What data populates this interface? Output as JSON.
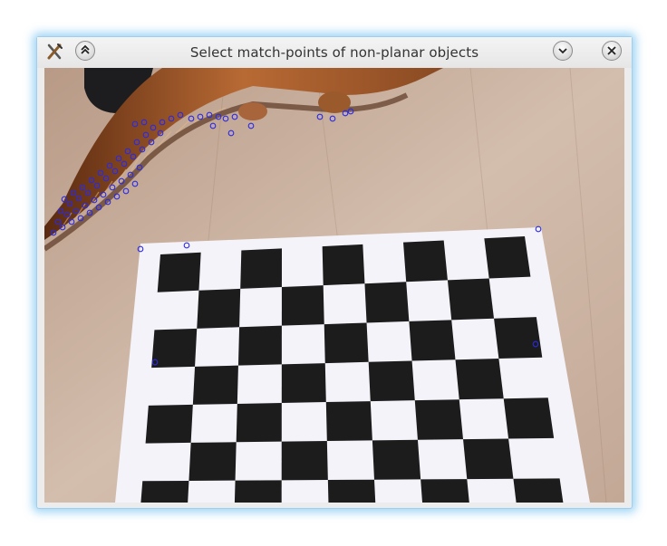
{
  "window": {
    "title": "Select match-points of non-planar objects",
    "buttons": {
      "app_menu": "app-menu-icon",
      "keep_above": "keep-above-icon",
      "minimize": "minimize-icon",
      "close": "close-icon"
    }
  },
  "colors": {
    "frame_glow": "#7cc4f0",
    "match_point": "#2a2ae6",
    "checker_dark": "#1c1c1c",
    "paper": "#f4f3f9",
    "floor": "#cdb29e"
  }
}
